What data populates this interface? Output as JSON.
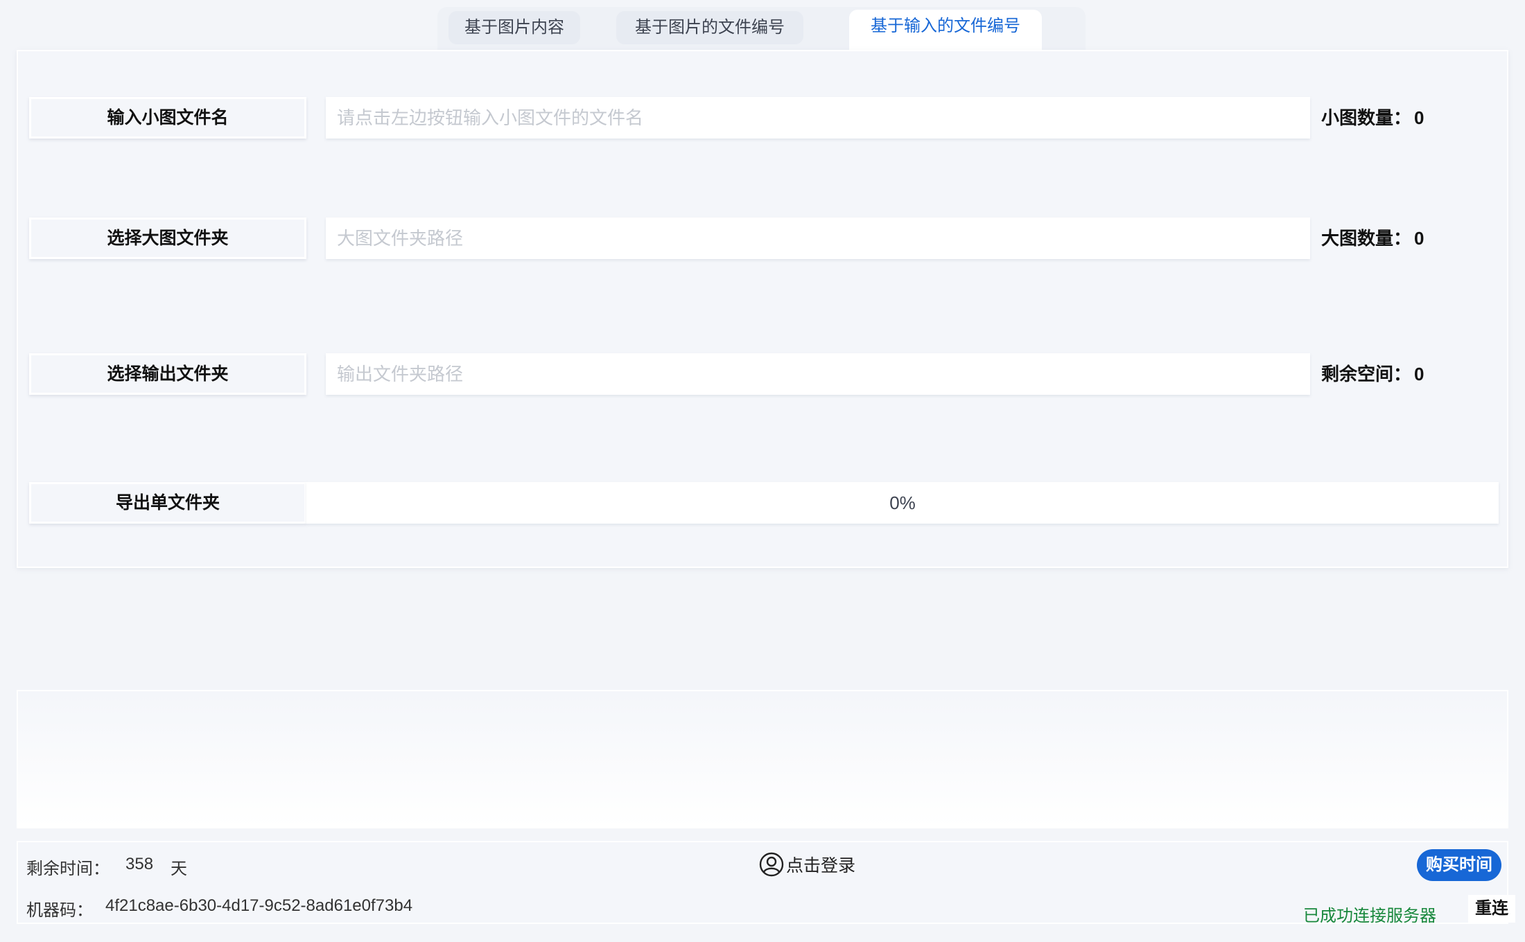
{
  "tabs": [
    {
      "label": "基于图片内容"
    },
    {
      "label": "基于图片的文件编号"
    },
    {
      "label": "基于输入的文件编号"
    }
  ],
  "form": {
    "small_btn": "输入小图文件名",
    "small_placeholder": "请点击左边按钮输入小图文件的文件名",
    "small_count_label": "小图数量：",
    "small_count": "0",
    "big_btn": "选择大图文件夹",
    "big_placeholder": "大图文件夹路径",
    "big_count_label": "大图数量：",
    "big_count": "0",
    "out_btn": "选择输出文件夹",
    "out_placeholder": "输出文件夹路径",
    "space_label": "剩余空间：",
    "space_value": "0",
    "export_btn": "导出单文件夹",
    "progress_text": "0%",
    "progress_value": 0
  },
  "footer": {
    "remaining_label": "剩余时间：",
    "remaining_value": "358",
    "remaining_unit": "天",
    "login_label": "点击登录",
    "buy_label": "购买时间",
    "machine_label": "机器码：",
    "machine_code": "4f21c8ae-6b30-4d17-9c52-8ad61e0f73b4",
    "status_text": "已成功连接服务器",
    "reconnect_label": "重连"
  },
  "colors": {
    "accent": "#1767d6",
    "success": "#18883c",
    "background": "#f3f5f9"
  }
}
